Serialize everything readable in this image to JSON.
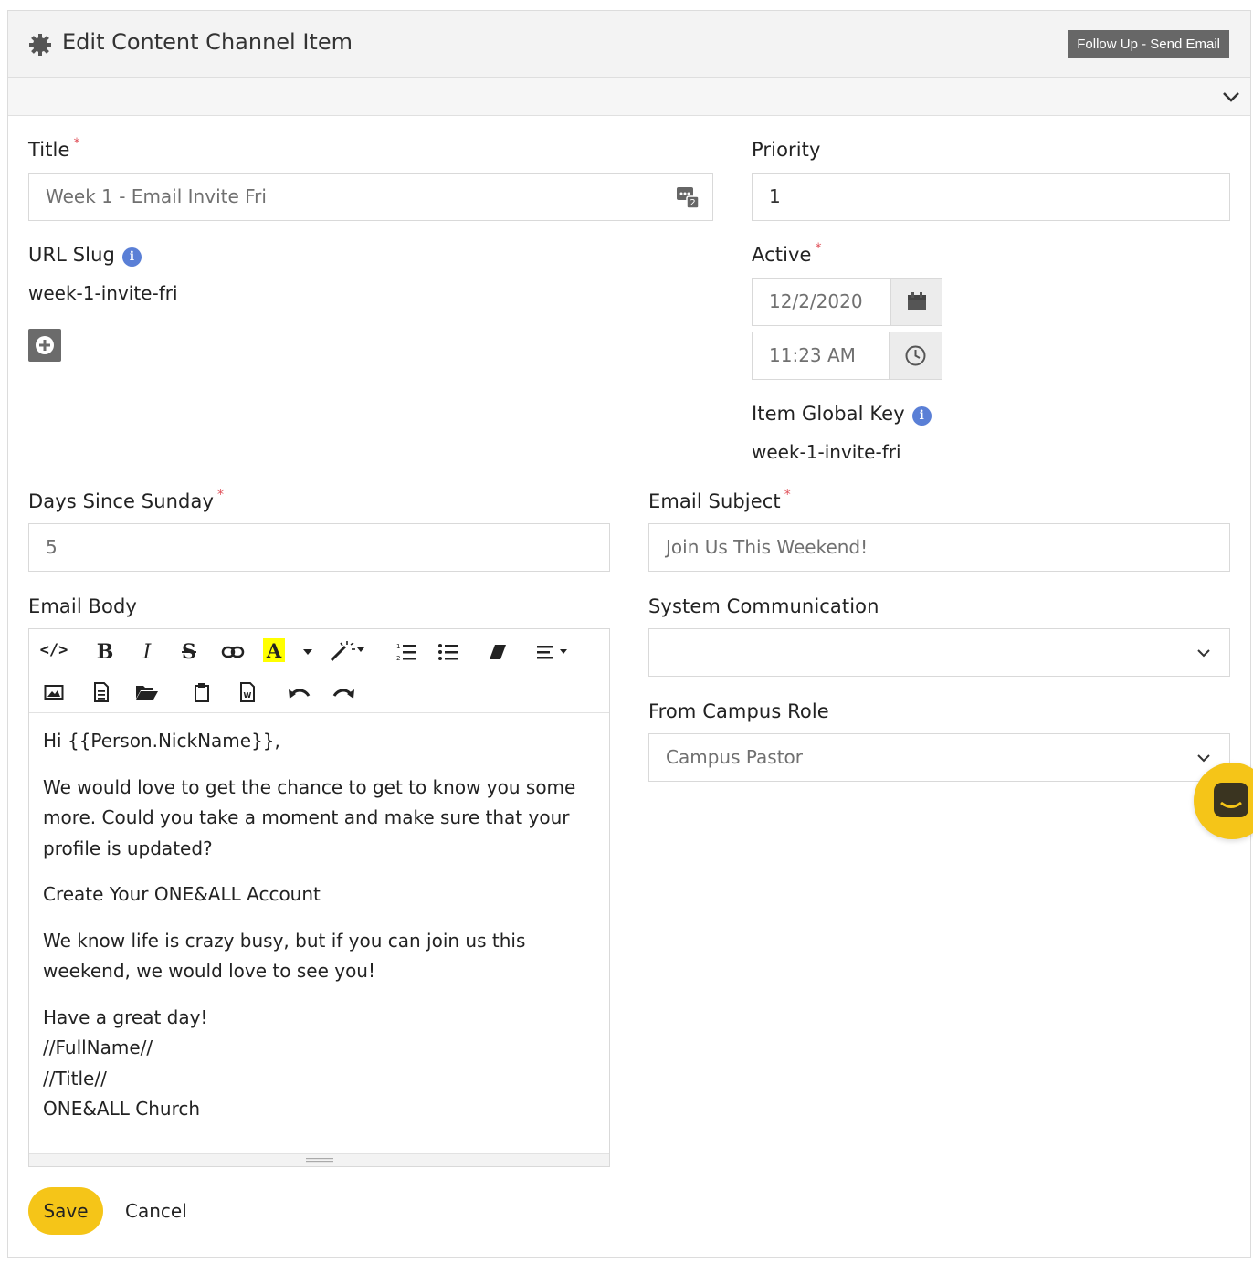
{
  "header": {
    "title": "Edit Content Channel Item",
    "badge": "Follow Up - Send Email",
    "icon": "gear-icon"
  },
  "fields": {
    "title": {
      "label": "Title",
      "value": "Week 1 - Email Invite Fri",
      "required": true
    },
    "priority": {
      "label": "Priority",
      "value": "1"
    },
    "url_slug": {
      "label": "URL Slug",
      "value": "week-1-invite-fri"
    },
    "active": {
      "label": "Active",
      "date": "12/2/2020",
      "time": "11:23 AM",
      "required": true
    },
    "item_global_key": {
      "label": "Item Global Key",
      "value": "week-1-invite-fri"
    },
    "days_since_sunday": {
      "label": "Days Since Sunday",
      "value": "5",
      "required": true
    },
    "email_subject": {
      "label": "Email Subject",
      "value": "Join Us This Weekend!",
      "required": true
    },
    "email_body": {
      "label": "Email Body"
    },
    "system_communication": {
      "label": "System Communication",
      "value": ""
    },
    "from_campus_role": {
      "label": "From Campus Role",
      "value": "Campus Pastor"
    }
  },
  "required_mark": "*",
  "info_mark": "i",
  "email_body": {
    "greeting": "Hi {{Person.NickName}},",
    "p1": "We would love to get the chance to get to know you some more. Could you take a moment and make sure that your profile is updated?",
    "p2": "Create Your ONE&ALL Account",
    "p3": "We know life is crazy busy, but if you can join us this weekend, we would love to see you!",
    "sign1": "Have a great day!",
    "sign2": "//FullName//",
    "sign3": "//Title//",
    "sign4": "ONE&ALL Church"
  },
  "toolbar": {
    "code": "</>",
    "bold": "B",
    "italic": "I",
    "strike": "S",
    "color": "A"
  },
  "actions": {
    "save": "Save",
    "cancel": "Cancel"
  },
  "colors": {
    "accent": "#f5c518",
    "info": "#5a7fd6",
    "required": "#e0515a",
    "badge": "#676767"
  }
}
